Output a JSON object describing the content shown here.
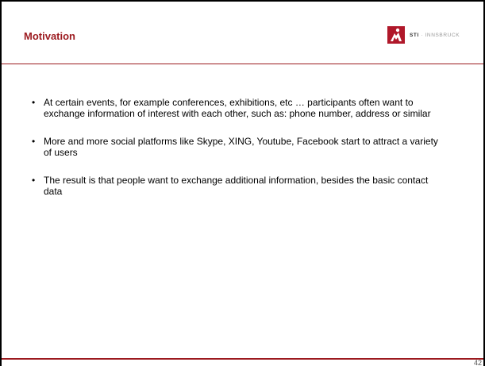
{
  "slide": {
    "title": "Motivation",
    "logo": {
      "name": "sti-innsbruck-logo",
      "text_strong": "STI",
      "text_light": " · INNSBRUCK",
      "color": "#b0182a"
    },
    "bullets": [
      {
        "marker": "•",
        "text": "At certain events, for example conferences, exhibitions, etc … participants often want to exchange information of interest with each other, such as: phone number, address or similar"
      },
      {
        "marker": "•",
        "text": "More and more social platforms like Skype, XING, Youtube, Facebook start to attract a variety of users"
      },
      {
        "marker": "•",
        "text": "The result is that people want to exchange additional information, besides the basic contact data"
      }
    ],
    "page_number": "42",
    "accent_color": "#9c1a1f"
  }
}
